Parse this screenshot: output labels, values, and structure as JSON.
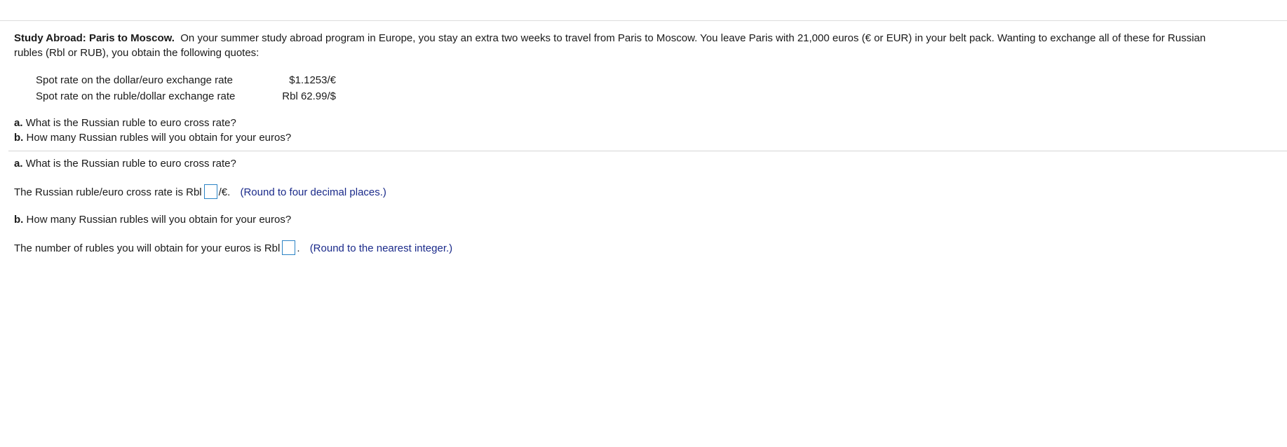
{
  "problem": {
    "title": "Study Abroad: Paris to Moscow.",
    "text_line1": "On your summer study abroad program in Europe, you stay an extra two weeks to travel from Paris to Moscow. You leave Paris with 21,000 euros (€ or EUR) in your belt pack. Wanting to exchange all of these for Russian",
    "text_line2": "rubles (Rbl or RUB), you obtain the following quotes:"
  },
  "quotes": [
    {
      "label": "Spot rate on the dollar/euro exchange rate",
      "value": "$1.1253/€"
    },
    {
      "label": "Spot rate on the ruble/dollar exchange rate",
      "value": "Rbl 62.99/$"
    }
  ],
  "questions": {
    "a_prefix": "a.",
    "a_text": "What is the Russian ruble to euro cross rate?",
    "b_prefix": "b.",
    "b_text": "How many Russian rubles will you obtain for your euros?"
  },
  "answer_a": {
    "heading_prefix": "a.",
    "heading_text": "What is the Russian ruble to euro cross rate?",
    "sentence_before": "The Russian ruble/euro cross rate is Rbl",
    "sentence_after": "/€.",
    "hint": "(Round to four decimal places.)",
    "input_value": ""
  },
  "answer_b": {
    "heading_prefix": "b.",
    "heading_text": "How many Russian rubles will you obtain for your euros?",
    "sentence_before": "The number of rubles you will obtain for your euros is Rbl",
    "sentence_after": ".",
    "hint": "(Round to the nearest integer.)",
    "input_value": ""
  },
  "colors": {
    "input_border": "#2b83c5",
    "hint_text": "#1a2a8a",
    "rule": "#dcdcdc"
  }
}
